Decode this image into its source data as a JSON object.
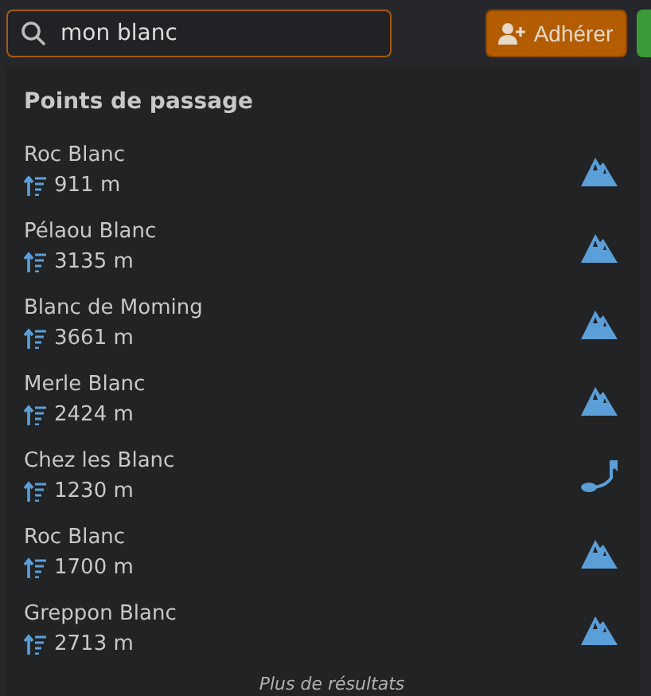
{
  "search": {
    "value": "mon blanc"
  },
  "join_button": {
    "label": "Adhérer"
  },
  "results": {
    "heading": "Points de passage",
    "items": [
      {
        "name": "Roc Blanc",
        "elevation": "911 m",
        "kind": "peak"
      },
      {
        "name": "Pélaou Blanc",
        "elevation": "3135 m",
        "kind": "peak"
      },
      {
        "name": "Blanc de Moming",
        "elevation": "3661 m",
        "kind": "peak"
      },
      {
        "name": "Merle Blanc",
        "elevation": "2424 m",
        "kind": "peak"
      },
      {
        "name": "Chez les Blanc",
        "elevation": "1230 m",
        "kind": "pass"
      },
      {
        "name": "Roc Blanc",
        "elevation": "1700 m",
        "kind": "peak"
      },
      {
        "name": "Greppon Blanc",
        "elevation": "2713 m",
        "kind": "peak"
      }
    ],
    "more": "Plus de résultats"
  }
}
